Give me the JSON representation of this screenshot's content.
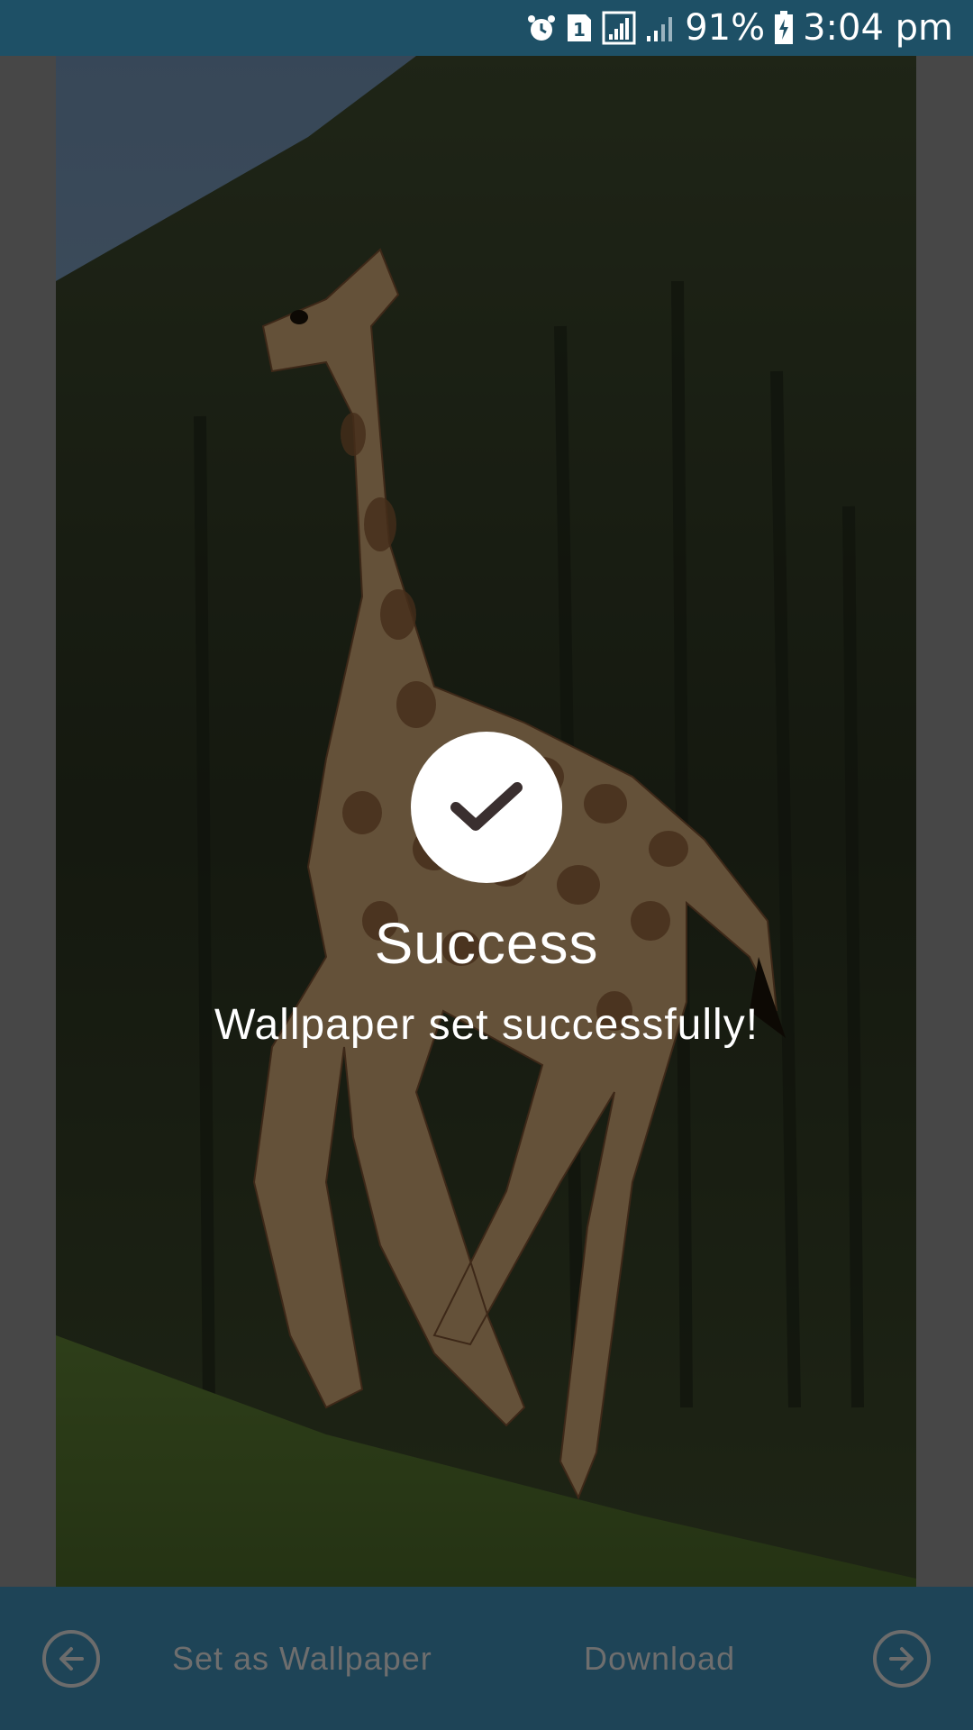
{
  "status_bar": {
    "battery_percent": "91%",
    "time": "3:04 pm",
    "sim_label": "1",
    "icons": [
      "alarm-icon",
      "sim-icon",
      "signal-icon",
      "signal-weak-icon",
      "battery-charging-icon"
    ]
  },
  "viewer": {
    "image_subject": "giraffe-wallpaper"
  },
  "dialog": {
    "title": "Success",
    "message": "Wallpaper set successfully!",
    "icon": "checkmark-icon"
  },
  "bottom_bar": {
    "prev_icon": "arrow-left-circle-icon",
    "set_wallpaper_label": "Set as Wallpaper",
    "download_label": "Download",
    "next_icon": "arrow-right-circle-icon"
  },
  "colors": {
    "status_bar": "#1e5066",
    "bottom_bar": "#1e4457",
    "bar_text": "#6e6e6e",
    "overlay_text": "#ffffff"
  }
}
